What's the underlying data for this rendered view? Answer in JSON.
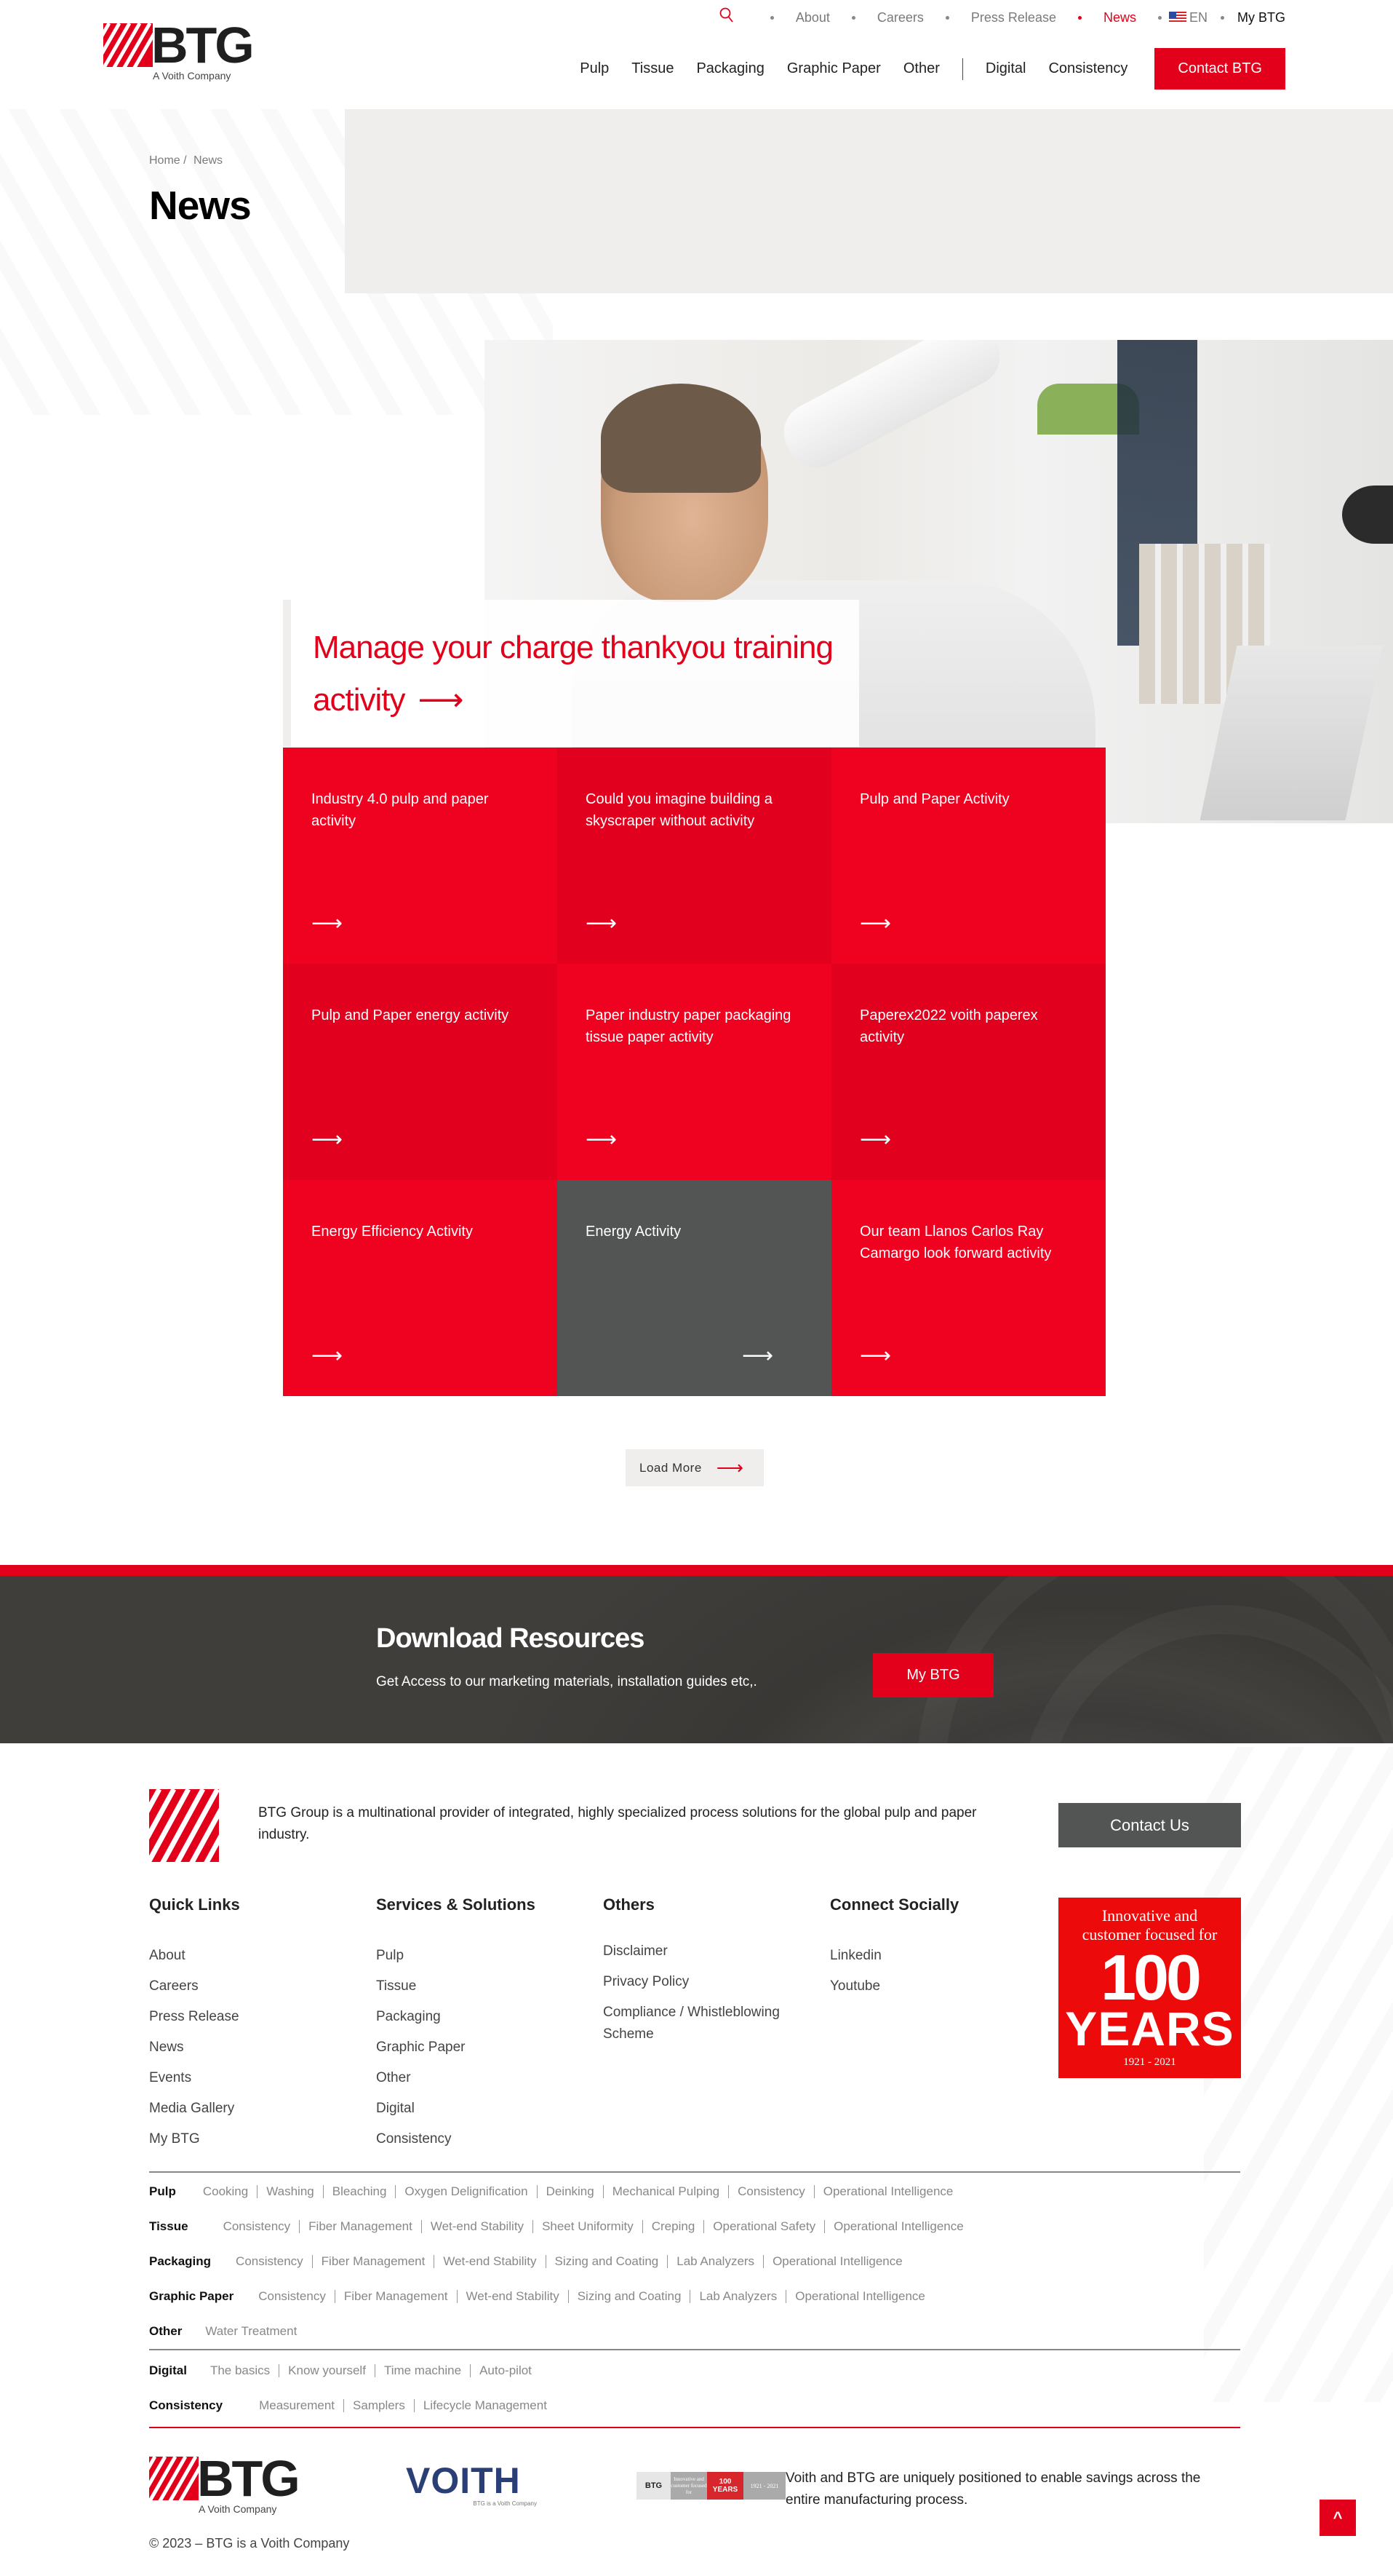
{
  "brand": {
    "name": "BTG",
    "tagline": "A Voith Company",
    "accent_color": "#e2001a",
    "dark_color": "#525553"
  },
  "topbar": {
    "search_icon": "search-icon",
    "items": [
      {
        "label": "About"
      },
      {
        "label": "Careers"
      },
      {
        "label": "Press Release"
      },
      {
        "label": "News",
        "active": true
      },
      {
        "label": "EN",
        "icon": "us-flag-icon"
      },
      {
        "label": "My BTG"
      }
    ]
  },
  "mainnav": {
    "items": [
      "Pulp",
      "Tissue",
      "Packaging",
      "Graphic Paper",
      "Other"
    ],
    "items_secondary": [
      "Digital",
      "Consistency"
    ],
    "cta": "Contact BTG"
  },
  "hero": {
    "breadcrumb": [
      "Home",
      "/",
      "News"
    ],
    "title": "News"
  },
  "featured": {
    "title": "Manage your charge thankyou training activity",
    "arrow": "⟶"
  },
  "news": [
    {
      "title": "Industry 4.0 pulp and paper activity",
      "style": "red"
    },
    {
      "title": "Could you imagine building a skyscraper without activity",
      "style": "dark"
    },
    {
      "title": "Pulp and Paper Activity",
      "style": "red"
    },
    {
      "title": "Pulp and Paper energy activity",
      "style": "dark"
    },
    {
      "title": "Paper industry paper packaging tissue paper activity",
      "style": "red"
    },
    {
      "title": "Paperex2022 voith paperex activity",
      "style": "dark"
    },
    {
      "title": "Energy Efficiency Activity",
      "style": "red"
    },
    {
      "title": "Energy Activity",
      "style": "grey"
    },
    {
      "title": "Our team Llanos Carlos Ray Camargo look forward activity",
      "style": "red"
    }
  ],
  "tile_arrow": "⟶",
  "load_more": {
    "label": "Load More",
    "arrow": "⟶"
  },
  "download": {
    "title": "Download Resources",
    "subtitle": "Get Access to our marketing materials, installation guides etc,.",
    "button": "My BTG"
  },
  "footer": {
    "about": "BTG Group is a multinational provider of integrated, highly specialized process solutions for the global pulp and paper industry.",
    "contact_button": "Contact Us",
    "columns": [
      {
        "title": "Quick Links",
        "links": [
          "About",
          "Careers",
          "Press Release",
          "News",
          "Events",
          "Media Gallery",
          "My BTG"
        ]
      },
      {
        "title": "Services & Solutions",
        "links": [
          "Pulp",
          "Tissue",
          "Packaging",
          "Graphic Paper",
          "Other",
          "Digital",
          "Consistency"
        ]
      },
      {
        "title": "Others",
        "links": [
          "Disclaimer",
          "Privacy Policy",
          "Compliance / Whistleblowing Scheme"
        ]
      },
      {
        "title": "Connect Socially",
        "links": [
          "Linkedin",
          "Youtube"
        ]
      }
    ],
    "badge": {
      "line1": "Innovative and",
      "line2": "customer focused for",
      "big": "100",
      "years": "YEARS",
      "range": "1921 - 2021"
    },
    "services": [
      {
        "category": "Pulp",
        "links": [
          "Cooking",
          "Washing",
          "Bleaching",
          "Oxygen Delignification",
          "Deinking",
          "Mechanical Pulping",
          "Consistency",
          "Operational Intelligence"
        ]
      },
      {
        "category": "Tissue",
        "links": [
          "Consistency",
          "Fiber Management",
          "Wet-end Stability",
          "Sheet Uniformity",
          "Creping",
          "Operational Safety",
          "Operational Intelligence"
        ]
      },
      {
        "category": "Packaging",
        "links": [
          "Consistency",
          "Fiber Management",
          "Wet-end Stability",
          "Sizing and Coating",
          "Lab Analyzers",
          "Operational Intelligence"
        ]
      },
      {
        "category": "Graphic Paper",
        "links": [
          "Consistency",
          "Fiber Management",
          "Wet-end Stability",
          "Sizing and Coating",
          "Lab Analyzers",
          "Operational Intelligence"
        ]
      },
      {
        "category": "Other",
        "links": [
          "Water Treatment"
        ]
      }
    ],
    "digital_rows": [
      {
        "category": "Digital",
        "links": [
          "The basics",
          "Know yourself",
          "Time machine",
          "Auto-pilot"
        ]
      },
      {
        "category": "Consistency",
        "links": [
          "Measurement",
          "Samplers",
          "Lifecycle Management"
        ]
      }
    ],
    "voith": {
      "name": "VOITH",
      "sub": "BTG is a Voith Company"
    },
    "mini_badge": {
      "brand": "BTG",
      "text": "Innovative and customer focused for",
      "big": "100",
      "years": "YEARS",
      "range": "1921 - 2021"
    },
    "voith_text": "Voith and BTG are uniquely positioned to enable savings across the entire manufacturing process.",
    "copyright": "© 2023 – BTG is a Voith Company",
    "to_top": "^"
  }
}
